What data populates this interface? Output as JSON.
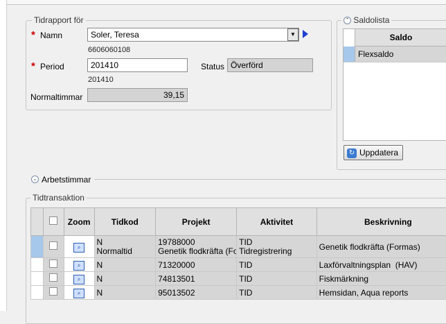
{
  "tidrapport": {
    "legend": "Tidrapport för",
    "namn_label": "Namn",
    "namn_value": "Soler, Teresa",
    "namn_sub": "6606060108",
    "period_label": "Period",
    "period_value": "201410",
    "period_sub": "201410",
    "status_label": "Status",
    "status_value": "Överförd",
    "normal_label": "Normaltimmar",
    "normal_value": "39,15"
  },
  "saldolista": {
    "legend": "Saldolista",
    "header": "Saldo",
    "rows": [
      "Flexsaldo"
    ],
    "update_button": "Uppdatera"
  },
  "arbetstimmar": {
    "label": "Arbetstimmar"
  },
  "tidtransaktion": {
    "legend": "Tidtransaktion",
    "columns": [
      "Zoom",
      "Tidkod",
      "Projekt",
      "Aktivitet",
      "Beskrivning"
    ],
    "rows": [
      {
        "tidkod": "N",
        "tidkod2": "Normaltid",
        "projekt": "19788000",
        "projekt2": "Genetik flodkräfta (For",
        "aktivitet": "TID",
        "aktivitet2": "Tidregistrering",
        "beskrivning": "Genetik flodkräfta (Formas)"
      },
      {
        "tidkod": "N",
        "tidkod2": "",
        "projekt": "71320000",
        "projekt2": "",
        "aktivitet": "TID",
        "aktivitet2": "",
        "beskrivning": "Laxförvaltningsplan  (HAV)"
      },
      {
        "tidkod": "N",
        "tidkod2": "",
        "projekt": "74813501",
        "projekt2": "",
        "aktivitet": "TID",
        "aktivitet2": "",
        "beskrivning": "Fiskmärkning"
      },
      {
        "tidkod": "N",
        "tidkod2": "",
        "projekt": "95013502",
        "projekt2": "",
        "aktivitet": "TID",
        "aktivitet2": "",
        "beskrivning": "Hemsidan, Aqua reports"
      }
    ]
  }
}
